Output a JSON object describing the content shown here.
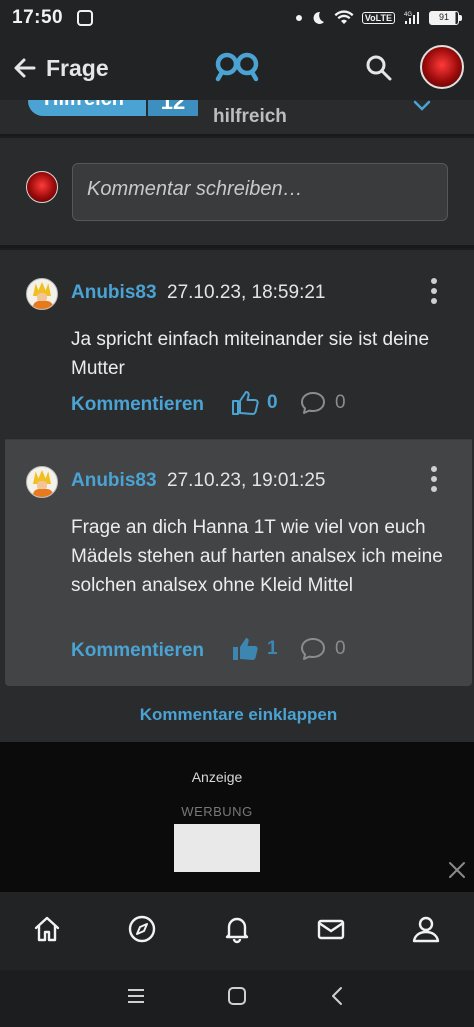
{
  "status_bar": {
    "time": "17:50",
    "network": "VoLTE",
    "network_gen": "4G",
    "battery": "91"
  },
  "header": {
    "title": "Frage",
    "back_icon": "arrow-left-icon",
    "logo_icon": "gutefrage-logo-icon",
    "search_icon": "search-icon"
  },
  "top_card": {
    "helpful_label": "Hilfreich",
    "helpful_count": "12",
    "helpful_text": "hilfreich"
  },
  "comment_input": {
    "placeholder": "Kommentar schreiben…"
  },
  "comments": [
    {
      "user": "Anubis83",
      "date": "27.10.23, 18:59:21",
      "text": "Ja spricht einfach miteinander sie ist deine Mutter",
      "action": "Kommentieren",
      "likes": "0",
      "replies": "0"
    },
    {
      "user": "Anubis83",
      "date": "27.10.23, 19:01:25",
      "text": "Frage an dich Hanna 1T wie viel von euch Mädels stehen auf harten analsex ich meine solchen analsex ohne Kleid Mittel",
      "action": "Kommentieren",
      "likes": "1",
      "replies": "0"
    }
  ],
  "collapse_label": "Kommentare einklappen",
  "ad": {
    "label": "Anzeige",
    "sub": "WERBUNG"
  },
  "bottom_nav": [
    "home-icon",
    "compass-icon",
    "bell-icon",
    "mail-icon",
    "profile-icon"
  ],
  "colors": {
    "accent": "#4aa3d3",
    "background": "#1c1d1f",
    "card": "#2a2b2d",
    "highlight_card": "#424446"
  }
}
